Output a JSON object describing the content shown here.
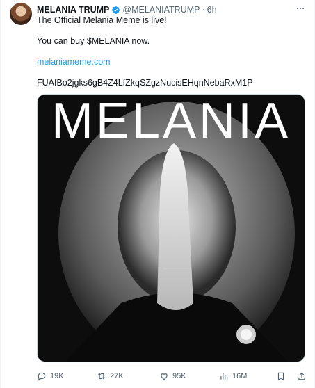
{
  "author": {
    "name": "MELANIA TRUMP",
    "handle": "@MELANIATRUMP",
    "separator": "·",
    "time": "6h"
  },
  "tweet": {
    "line1": "The Official Melania Meme is live!",
    "line2": "You can buy $MELANIA now.",
    "link": "melaniameme.com",
    "contract": "FUAfBo2jgks6gB4Z4LfZkqSZgzNucisEHqnNebaRxM1P"
  },
  "media": {
    "overlay_text": "MELANIA"
  },
  "actions": {
    "replies": "19K",
    "reposts": "27K",
    "likes": "95K",
    "views": "16M"
  },
  "colors": {
    "accent": "#1d9bf0",
    "secondary_text": "#536471",
    "primary_text": "#0f1419"
  },
  "icons": [
    "verified-badge-icon",
    "more-icon",
    "reply-icon",
    "repost-icon",
    "like-icon",
    "views-icon",
    "bookmark-icon",
    "share-icon"
  ]
}
